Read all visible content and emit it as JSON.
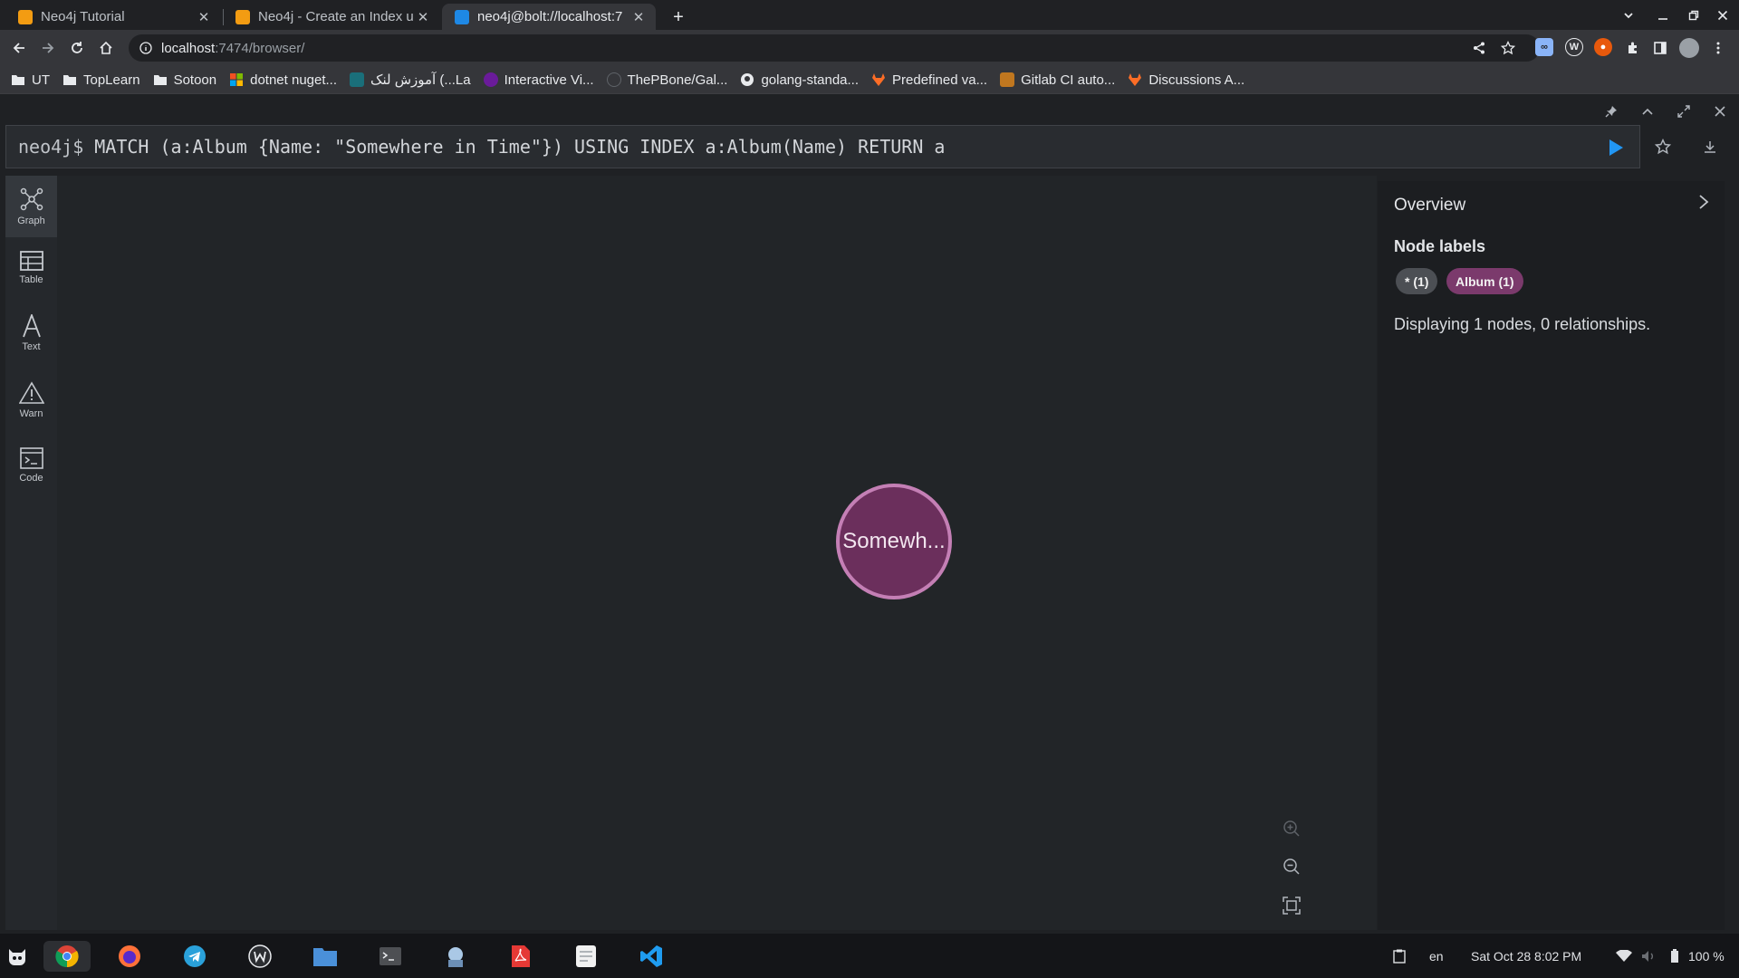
{
  "browser": {
    "tabs": [
      {
        "title": "Neo4j Tutorial",
        "active": false
      },
      {
        "title": "Neo4j - Create an Index u",
        "active": false
      },
      {
        "title": "neo4j@bolt://localhost:7",
        "active": true
      }
    ],
    "url_host": "localhost",
    "url_path": ":7474/browser/",
    "bookmarks": [
      "UT",
      "TopLearn",
      "Sotoon",
      "dotnet nuget...",
      "آموزش لنک (...La",
      "Interactive Vi...",
      "ThePBone/Gal...",
      "golang-standa...",
      "Predefined va...",
      "Gitlab CI auto...",
      "Discussions A..."
    ]
  },
  "neo4j": {
    "prompt": "neo4j$",
    "query": "MATCH (a:Album {Name: \"Somewhere in Time\"}) USING INDEX a:Album(Name) RETURN a",
    "nav": [
      {
        "label": "Graph",
        "icon": "graph-icon",
        "active": true
      },
      {
        "label": "Table",
        "icon": "table-icon",
        "active": false
      },
      {
        "label": "Text",
        "icon": "text-icon",
        "active": false
      },
      {
        "label": "Warn",
        "icon": "warning-icon",
        "active": false
      },
      {
        "label": "Code",
        "icon": "code-icon",
        "active": false
      }
    ],
    "node": {
      "caption": "Somewh...",
      "fill": "#6b2f5c",
      "stroke": "#c47fb5"
    },
    "overview": {
      "title": "Overview",
      "node_labels_title": "Node labels",
      "chips": [
        {
          "text": "* (1)",
          "color": "#4c4f54"
        },
        {
          "text": "Album (1)",
          "color": "#7b3a6c"
        }
      ],
      "description": "Displaying 1 nodes, 0 relationships."
    }
  },
  "taskbar": {
    "language": "en",
    "datetime": "Sat Oct 28   8:02 PM",
    "battery": "100 %"
  },
  "colors": {
    "accent": "#2196f3",
    "node": "#6b2f5c"
  }
}
